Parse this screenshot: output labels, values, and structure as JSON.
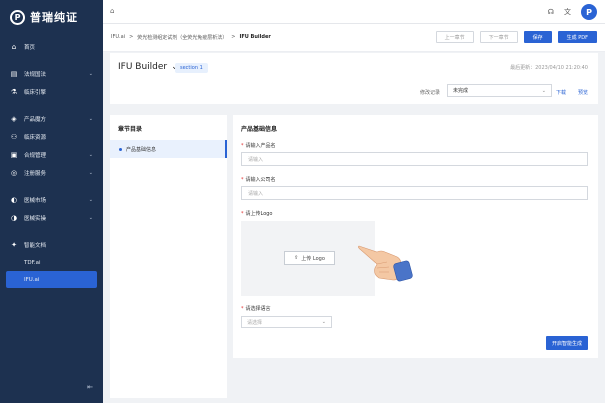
{
  "app": {
    "brand": "普瑞纯证",
    "brand_mark": "P",
    "colors": {
      "sidebar": "#1d3150",
      "accent": "#2a63d4",
      "active_item": "#2a63d4",
      "required": "#e02b2b"
    }
  },
  "sidebar": {
    "items": [
      {
        "icon": "home-icon",
        "label": "首页"
      },
      {
        "icon": "regulation-icon",
        "label": "法规国法",
        "chev": "⌄"
      },
      {
        "icon": "clinical-icon",
        "label": "临床引擎"
      },
      {
        "icon": "product-icon",
        "label": "产品魔方",
        "chev": "⌄"
      },
      {
        "icon": "resource-icon",
        "label": "临床资源"
      },
      {
        "icon": "compliance-icon",
        "label": "合规管理",
        "chev": "⌄"
      },
      {
        "icon": "registration-icon",
        "label": "注册服务",
        "chev": "⌄"
      },
      {
        "icon": "market-icon",
        "label": "医械市场",
        "chev": "⌄"
      },
      {
        "icon": "practice-icon",
        "label": "医械实操",
        "chev": "⌄"
      },
      {
        "icon": "doc-icon",
        "label": "智能文档"
      }
    ],
    "subitems": [
      {
        "label": "TDF.ai"
      },
      {
        "label": "IFU.ai"
      }
    ],
    "collapse_icon": "collapse-icon"
  },
  "topbar": {
    "avatar": "P"
  },
  "breadcrumb": {
    "items": [
      "IFU.ai",
      "荧光检测组定试剂（全荧光免疫层析法）",
      "IFU Builder"
    ],
    "sep": ">"
  },
  "toolbar": {
    "prev": "上一章节",
    "next": "下一章节",
    "save": "保存",
    "generate_pdf": "生成 PDF"
  },
  "header": {
    "title": "IFU Builder",
    "title_chev": "⌄",
    "tag": "section 1",
    "update_time": "最后更新：2023/04/10 21:20:40",
    "version_label": "修改记录",
    "version_value": "未完成",
    "download": "下载",
    "preview": "预览"
  },
  "toc": {
    "title": "章节目录",
    "items": [
      "产品基础信息"
    ]
  },
  "form": {
    "title": "产品基础信息",
    "product_name_label": "请输入产品名",
    "product_name_placeholder": "请输入",
    "company_label": "请输入公司名",
    "company_placeholder": "请输入",
    "logo_label": "请上传Logo",
    "upload_label": "上传 Logo",
    "language_label": "请选择语言",
    "language_placeholder": "请选择",
    "generate_btn": "开启智能生成"
  }
}
